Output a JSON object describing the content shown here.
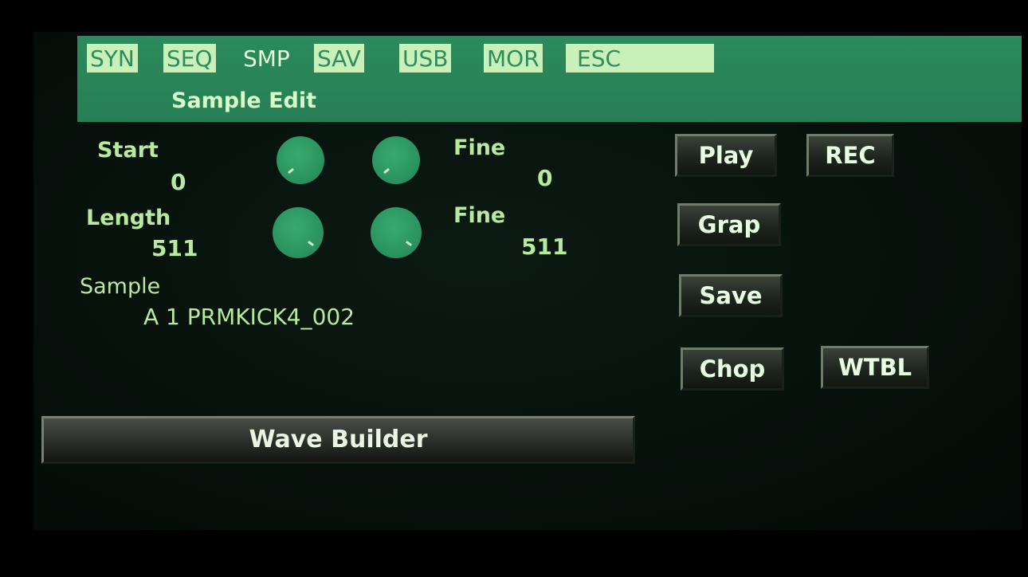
{
  "header": {
    "tabs": [
      {
        "label": "SYN",
        "active": false
      },
      {
        "label": "SEQ",
        "active": false
      },
      {
        "label": "SMP",
        "active": true
      },
      {
        "label": "SAV",
        "active": false
      },
      {
        "label": "USB",
        "active": false
      },
      {
        "label": "MOR",
        "active": false
      },
      {
        "label": "ESC",
        "active": false
      }
    ],
    "title": "Sample Edit"
  },
  "params": {
    "start": {
      "label": "Start",
      "value": "0"
    },
    "start_fine": {
      "label": "Fine",
      "value": "0"
    },
    "length": {
      "label": "Length",
      "value": "511"
    },
    "length_fine": {
      "label": "Fine",
      "value": "511"
    },
    "sample": {
      "label": "Sample",
      "value": "A 1 PRMKICK4_002"
    }
  },
  "buttons": {
    "play": "Play",
    "rec": "REC",
    "grap": "Grap",
    "save": "Save",
    "chop": "Chop",
    "wtbl": "WTBL",
    "wave_builder": "Wave Builder"
  },
  "knobs": [
    {
      "name": "start-coarse",
      "icon": "knob-icon"
    },
    {
      "name": "start-fine",
      "icon": "knob-icon"
    },
    {
      "name": "length-coarse",
      "icon": "knob-icon"
    },
    {
      "name": "length-fine",
      "icon": "knob-icon"
    }
  ],
  "colors": {
    "header_bg": "#2c8a5c",
    "tab_bg": "#c9f0b8",
    "text_green": "#b8ea9c",
    "knob_green": "#2b9461"
  }
}
